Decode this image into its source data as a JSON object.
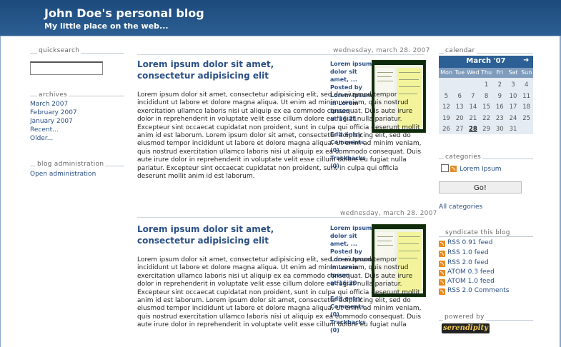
{
  "header": {
    "title": "John Doe's personal blog",
    "description": "My little place on the web..."
  },
  "left": {
    "quicksearch_title": "quicksearch",
    "search_value": "",
    "archives_title": "archives",
    "archives": [
      "March 2007",
      "February 2007",
      "January 2007",
      "Recent...",
      "Older..."
    ],
    "admin_title": "blog administration",
    "admin_link": "Open administration"
  },
  "entries": [
    {
      "date": "wednesday, march 28. 2007",
      "title": "Lorem ipsum dolor sit amet, consectetur adipisicing elit",
      "meta_title": "Lorem ipsum dolor sit amet, ...",
      "posted_by": "Posted by",
      "author": "Lorem Ipsum",
      "in": "in",
      "category": "Lorem Ipsum",
      "at": "at",
      "time": "16:21",
      "edit": "Edit entry",
      "comments": "Comments (0)",
      "trackbacks": "Trackbacks (0)",
      "body": "Lorem ipsum dolor sit amet, consectetur adipisicing elit, sed do eiusmod tempor incididunt ut labore et dolore magna aliqua. Ut enim ad minim veniam, quis nostrud exercitation ullamco laboris nisi ut aliquip ex ea commodo consequat. Duis aute irure dolor in reprehenderit in voluptate velit esse cillum dolore eu fugiat nulla pariatur. Excepteur sint occaecat cupidatat non proident, sunt in culpa qui officia deserunt mollit anim id est laborum. Lorem ipsum dolor sit amet, consectetur adipisicing elit, sed do eiusmod tempor incididunt ut labore et dolore magna aliqua. Ut enim ad minim veniam, quis nostrud exercitation ullamco laboris nisi ut aliquip ex ea commodo consequat. Duis aute irure dolor in reprehenderit in voluptate velit esse cillum dolore eu fugiat nulla pariatur. Excepteur sint occaecat cupidatat non proident, sunt in culpa qui officia deserunt mollit anim id est laborum."
    },
    {
      "date": "wednesday, march 28. 2007",
      "title": "Lorem ipsum dolor sit amet, consectetur adipisicing elit",
      "meta_title": "Lorem ipsum dolor sit amet, ...",
      "posted_by": "Posted by",
      "author": "Lorem Ipsum",
      "in": "in",
      "category": "Lorem Ipsum",
      "at": "at",
      "time": "16:20",
      "edit": "Edit entry",
      "comments": "Comments (0)",
      "trackbacks": "Trackbacks (0)",
      "body": "Lorem ipsum dolor sit amet, consectetur adipisicing elit, sed do eiusmod tempor incididunt ut labore et dolore magna aliqua. Ut enim ad minim veniam, quis nostrud exercitation ullamco laboris nisi ut aliquip ex ea commodo consequat. Duis aute irure dolor in reprehenderit in voluptate velit esse cillum dolore eu fugiat nulla pariatur. Excepteur sint occaecat cupidatat non proident, sunt in culpa qui officia deserunt mollit anim id est laborum. Lorem ipsum dolor sit amet, consectetur adipisicing elit, sed do eiusmod tempor incididunt ut labore et dolore magna aliqua. Ut enim ad minim veniam, quis nostrud exercitation ullamco laboris nisi ut aliquip ex ea commodo consequat. Duis aute irure dolor in reprehenderit in voluptate velit esse cillum dolore eu fugiat nulla"
    }
  ],
  "right": {
    "calendar_title": "calendar",
    "calendar_month": "March '07",
    "calendar_next": "➜",
    "days_of_week": [
      "Mon",
      "Tue",
      "Wed",
      "Thu",
      "Fri",
      "Sat",
      "Sun"
    ],
    "weeks": [
      [
        "",
        "",
        "",
        "1",
        "2",
        "3",
        "4"
      ],
      [
        "5",
        "6",
        "7",
        "8",
        "9",
        "10",
        "11"
      ],
      [
        "12",
        "13",
        "14",
        "15",
        "16",
        "17",
        "18"
      ],
      [
        "19",
        "20",
        "21",
        "22",
        "23",
        "24",
        "25"
      ],
      [
        "26",
        "27",
        "28",
        "29",
        "30",
        "31",
        ""
      ]
    ],
    "today": "28",
    "categories_title": "categories",
    "category_item": "Lorem Ipsum",
    "go_label": "Go!",
    "all_categories": "All categories",
    "syndicate_title": "syndicate this blog",
    "feeds": [
      "RSS 0.91 feed",
      "RSS 1.0 feed",
      "RSS 2.0 feed",
      "ATOM 0.3 feed",
      "ATOM 1.0 feed",
      "RSS 2.0 Comments"
    ],
    "powered_title": "powered by",
    "powered_logo": "serendipity"
  },
  "colors": {
    "header": "#2c5f93",
    "link": "#2a4f86",
    "calendar_bg": "#e4ebf3",
    "rss_orange": "#e98b23"
  }
}
